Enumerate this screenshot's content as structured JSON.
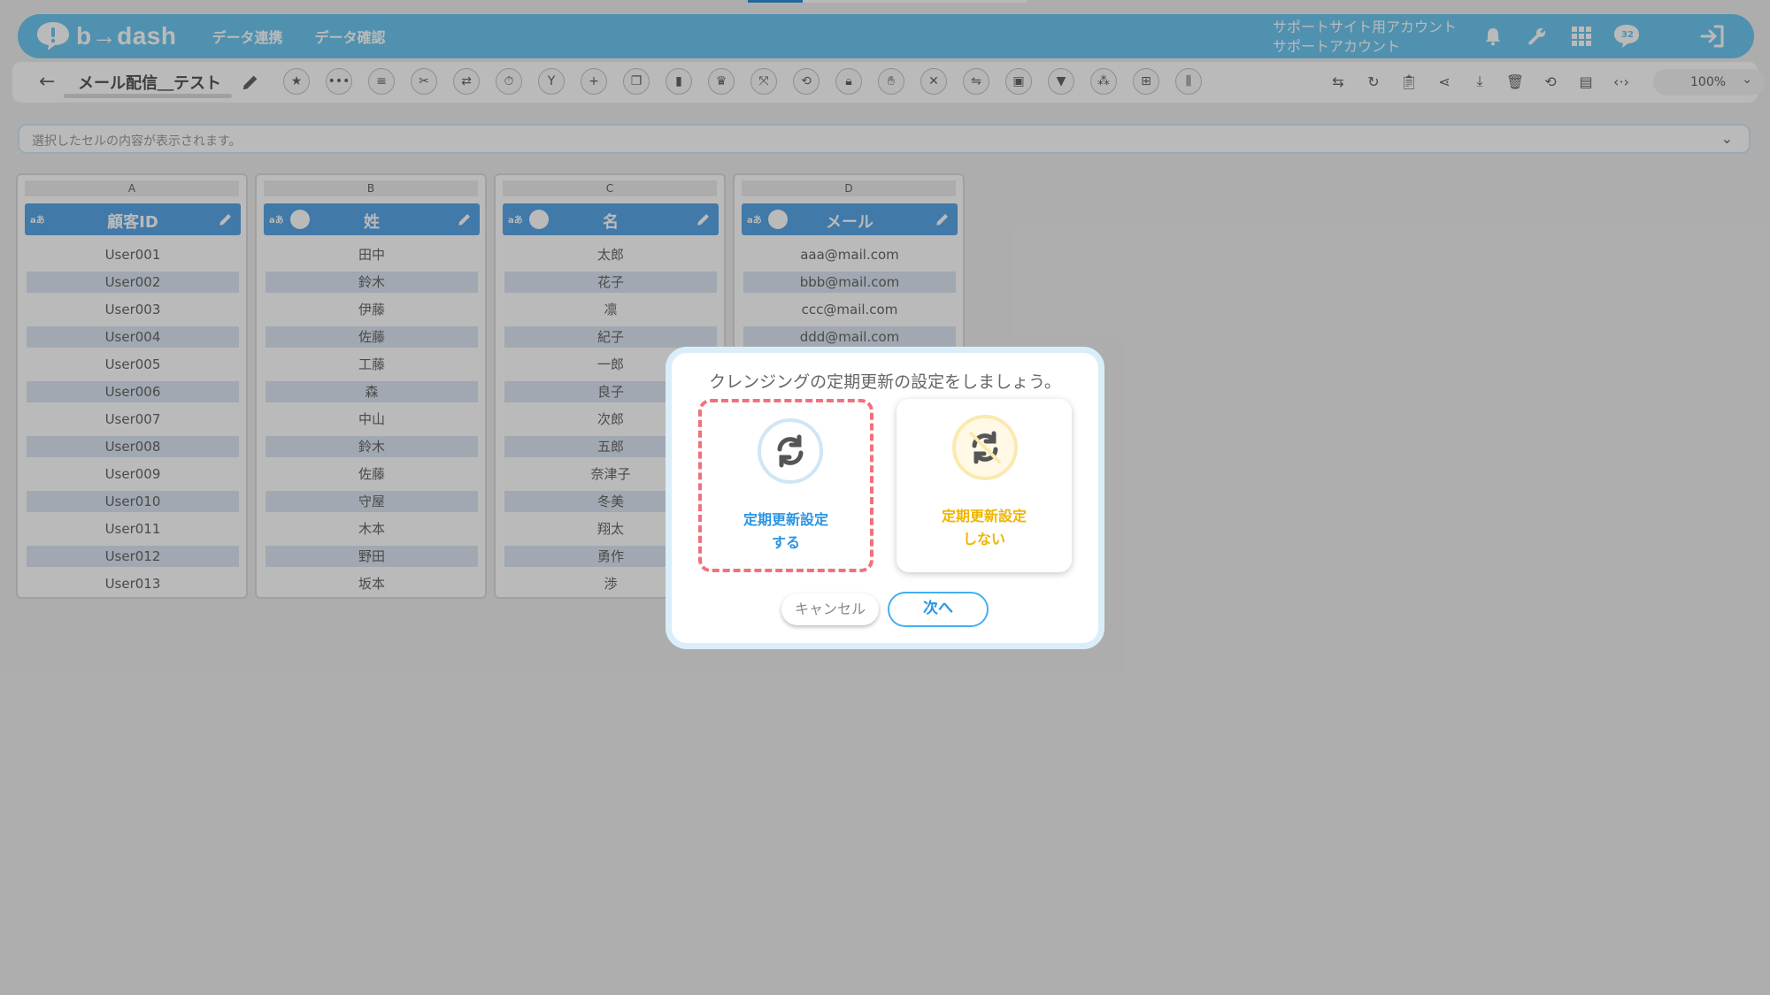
{
  "app": {
    "brand": "b→dash"
  },
  "header": {
    "nav": [
      "データ連携",
      "データ確認"
    ],
    "account_line1": "サポートサイト用アカウント",
    "account_line2": "サポートアカウント",
    "notification_count": "32"
  },
  "toolbar": {
    "back_icon": "←",
    "sheet_name": "メール配信＿テスト",
    "zoom": "100%"
  },
  "formula_bar": {
    "placeholder": "選択したセルの内容が表示されます。"
  },
  "columns": [
    {
      "letter": "A",
      "title": "顧客ID",
      "type_icon": "aあ",
      "cells": [
        "User001",
        "User002",
        "User003",
        "User004",
        "User005",
        "User006",
        "User007",
        "User008",
        "User009",
        "User010",
        "User011",
        "User012",
        "User013"
      ]
    },
    {
      "letter": "B",
      "title": "姓",
      "type_icon": "aあ",
      "cells": [
        "田中",
        "鈴木",
        "伊藤",
        "佐藤",
        "工藤",
        "森",
        "中山",
        "鈴木",
        "佐藤",
        "守屋",
        "木本",
        "野田",
        "坂本"
      ]
    },
    {
      "letter": "C",
      "title": "名",
      "type_icon": "aあ",
      "cells": [
        "太郎",
        "花子",
        "凛",
        "紀子",
        "一郎",
        "良子",
        "次郎",
        "五郎",
        "奈津子",
        "冬美",
        "翔太",
        "勇作",
        "渉"
      ]
    },
    {
      "letter": "D",
      "title": "メール",
      "type_icon": "aあ",
      "cells": [
        "aaa@mail.com",
        "bbb@mail.com",
        "ccc@mail.com",
        "ddd@mail.com"
      ]
    }
  ],
  "modal": {
    "title": "クレンジングの定期更新の設定をしましょう。",
    "option_on": {
      "line1": "定期更新設定",
      "line2": "する"
    },
    "option_off": {
      "line1": "定期更新設定",
      "line2": "しない"
    },
    "cancel_label": "キャンセル",
    "next_label": "次へ"
  },
  "colors": {
    "header_bg": "#6ec7f0",
    "column_header": "#5aa6e6",
    "option_on_text": "#2b95e2",
    "option_off_text": "#f0b400",
    "selected_border": "#f2707b"
  }
}
